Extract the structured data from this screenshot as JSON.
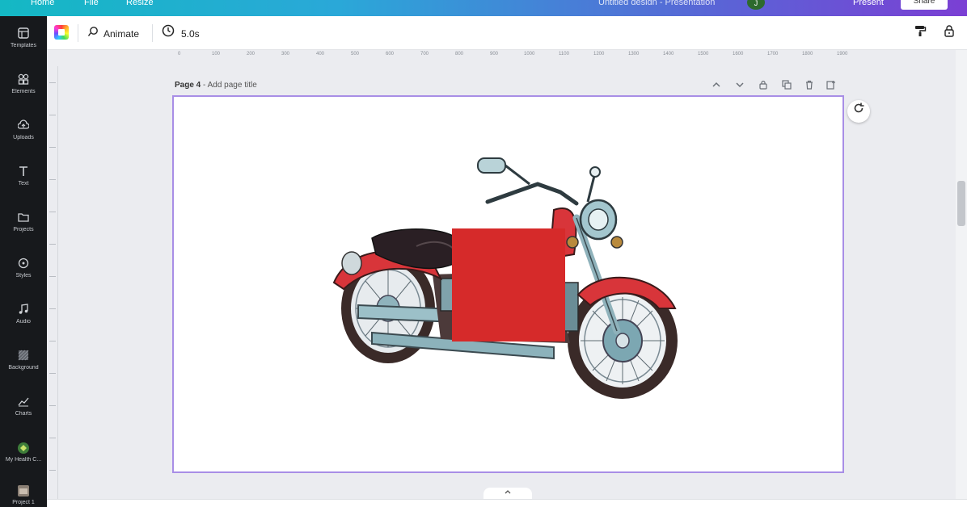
{
  "topbar": {
    "items": [
      "Home",
      "File",
      "Resize"
    ],
    "doc_title": "Untitled design - Presentation",
    "avatar_initial": "J",
    "present_label": "Present",
    "share_label": "Share"
  },
  "sidebar": {
    "items": [
      {
        "label": "Templates",
        "icon": "templates-icon"
      },
      {
        "label": "Elements",
        "icon": "elements-icon"
      },
      {
        "label": "Uploads",
        "icon": "uploads-icon"
      },
      {
        "label": "Text",
        "icon": "text-icon"
      },
      {
        "label": "Projects",
        "icon": "folder-icon"
      },
      {
        "label": "Styles",
        "icon": "styles-icon"
      },
      {
        "label": "Audio",
        "icon": "music-icon"
      },
      {
        "label": "Background",
        "icon": "background-icon"
      },
      {
        "label": "Charts",
        "icon": "charts-icon"
      },
      {
        "label": "My Health C...",
        "icon": "app-icon"
      },
      {
        "label": "Project 1",
        "icon": "app-icon"
      }
    ]
  },
  "toolbar": {
    "animate_label": "Animate",
    "duration_label": "5.0s"
  },
  "ruler": {
    "ticks": [
      "0",
      "100",
      "200",
      "300",
      "400",
      "500",
      "600",
      "700",
      "800",
      "900",
      "1000",
      "1100",
      "1200",
      "1300",
      "1400",
      "1500",
      "1600",
      "1700",
      "1800",
      "1900"
    ]
  },
  "page": {
    "number_label": "Page 4",
    "title_placeholder": "Add page title"
  },
  "canvas_elements": {
    "image": "motorcycle",
    "shape_color": "#d62a2a"
  },
  "colors": {
    "selection_border": "#a88ee6",
    "sidebar_bg": "#17191c",
    "accent_red": "#d62a2a"
  }
}
